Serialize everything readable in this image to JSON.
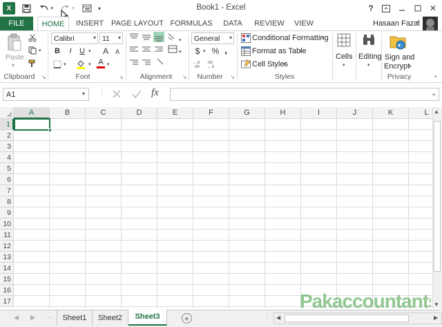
{
  "window": {
    "title": "Book1 - Excel",
    "help": "?",
    "restore_label": "⧉",
    "minimize": "—",
    "maximize": "□",
    "close": "✕"
  },
  "qat": {
    "app_icon": "excel-logo-icon",
    "save": "save-icon",
    "undo": "undo-icon",
    "redo": "redo-icon",
    "customize": "customize-icon"
  },
  "tabs": [
    {
      "label": "FILE"
    },
    {
      "label": "HOME"
    },
    {
      "label": "INSERT"
    },
    {
      "label": "PAGE LAYOUT"
    },
    {
      "label": "FORMULAS"
    },
    {
      "label": "DATA"
    },
    {
      "label": "REVIEW"
    },
    {
      "label": "VIEW"
    }
  ],
  "user": {
    "name": "Hasaan Fazal"
  },
  "ribbon": {
    "clipboard": {
      "label": "Clipboard",
      "paste": "Paste"
    },
    "font": {
      "label": "Font",
      "family": "Calibri",
      "size": "11",
      "bold": "B",
      "italic": "I",
      "underline": "U",
      "grow": "A",
      "shrink": "A",
      "color": "A"
    },
    "alignment": {
      "label": "Alignment"
    },
    "number": {
      "label": "Number",
      "format": "General",
      "currency": "$",
      "percent": "%",
      "comma": ","
    },
    "styles": {
      "label": "Styles",
      "conditional": "Conditional Formatting",
      "format_table": "Format as Table",
      "cell_styles": "Cell Styles"
    },
    "cells": {
      "label": "Cells"
    },
    "editing": {
      "label": "Editing"
    },
    "privacy": {
      "label": "Privacy",
      "sign": "Sign and",
      "encrypt": "Encrypt"
    }
  },
  "formula_bar": {
    "namebox": "A1",
    "fx": "fx",
    "value": ""
  },
  "columns": [
    "A",
    "B",
    "C",
    "D",
    "E",
    "F",
    "G",
    "H",
    "I",
    "J",
    "K",
    "L"
  ],
  "rows": [
    "1",
    "2",
    "3",
    "4",
    "5",
    "6",
    "7",
    "8",
    "9",
    "10",
    "11",
    "12",
    "13",
    "14",
    "15",
    "16",
    "17"
  ],
  "sheets": [
    {
      "name": "Sheet1",
      "active": false
    },
    {
      "name": "Sheet2",
      "active": false
    },
    {
      "name": "Sheet3",
      "active": true
    }
  ],
  "add_sheet": "+",
  "watermark": "Pakaccountants.com",
  "colors": {
    "accent": "#217346",
    "selection": "#217346"
  }
}
